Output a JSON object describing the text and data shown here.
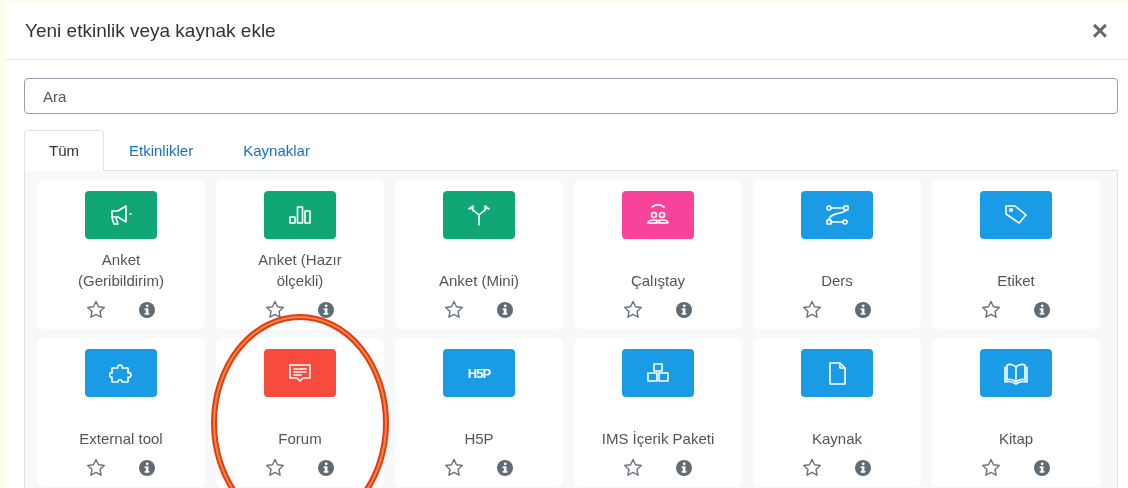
{
  "dialog": {
    "title": "Yeni etkinlik veya kaynak ekle",
    "close": "×"
  },
  "search": {
    "placeholder": "Ara"
  },
  "tabs": [
    {
      "label": "Tüm",
      "selected": true
    },
    {
      "label": "Etkinlikler",
      "selected": false
    },
    {
      "label": "Kaynaklar",
      "selected": false
    }
  ],
  "items": [
    {
      "name": "Anket (Geribildirim)",
      "kind": "megaphone",
      "color": "#11a676",
      "highlighted": false
    },
    {
      "name": "Anket (Hazır ölçekli)",
      "kind": "bars",
      "color": "#11a676",
      "highlighted": false
    },
    {
      "name": "Anket (Mini)",
      "kind": "fork",
      "color": "#11a676",
      "highlighted": false
    },
    {
      "name": "Çalıştay",
      "kind": "people",
      "color": "#f7449a",
      "highlighted": false
    },
    {
      "name": "Ders",
      "kind": "route",
      "color": "#1a9be6",
      "highlighted": false
    },
    {
      "name": "Etiket",
      "kind": "tag",
      "color": "#1a9be6",
      "highlighted": false
    },
    {
      "name": "External tool",
      "kind": "puzzle",
      "color": "#1a9be6",
      "highlighted": false
    },
    {
      "name": "Forum",
      "kind": "chat",
      "color": "#f74b3e",
      "highlighted": true
    },
    {
      "name": "H5P",
      "kind": "h5p",
      "icon_text": "H5P",
      "color": "#1a9be6",
      "highlighted": false
    },
    {
      "name": "IMS İçerik Paketi",
      "kind": "boxes",
      "color": "#1a9be6",
      "highlighted": false
    },
    {
      "name": "Kaynak",
      "kind": "file",
      "color": "#1a9be6",
      "highlighted": false
    },
    {
      "name": "Kitap",
      "kind": "book",
      "color": "#1a9be6",
      "highlighted": false
    }
  ]
}
